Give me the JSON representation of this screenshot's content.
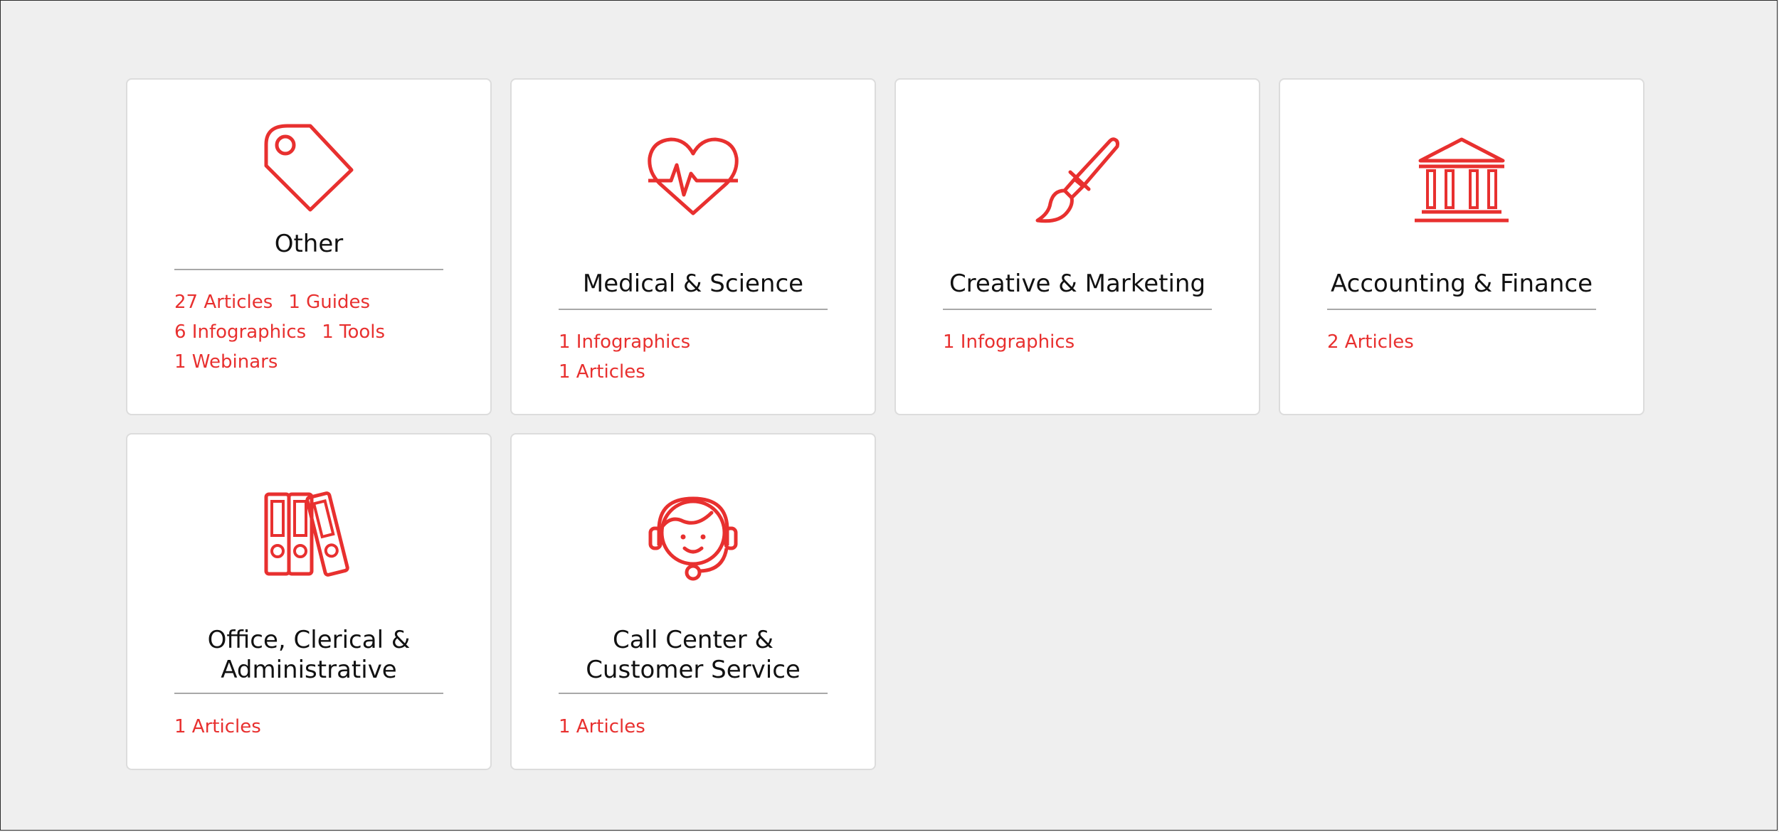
{
  "accent_color": "#e8302f",
  "cards": [
    {
      "icon": "tag-icon",
      "title": "Other",
      "links": [
        "27 Articles",
        "1 Guides",
        "6 Infographics",
        "1 Tools",
        "1 Webinars"
      ]
    },
    {
      "icon": "heartbeat-icon",
      "title": "Medical & Science",
      "links": [
        "1 Infographics",
        "1 Articles"
      ]
    },
    {
      "icon": "paintbrush-icon",
      "title": "Creative & Marketing",
      "links": [
        "1 Infographics"
      ]
    },
    {
      "icon": "bank-icon",
      "title": "Accounting & Finance",
      "links": [
        "2 Articles"
      ]
    },
    {
      "icon": "binders-icon",
      "title": "Office, Clerical & Administrative",
      "links": [
        "1 Articles"
      ]
    },
    {
      "icon": "headset-agent-icon",
      "title": "Call Center & Customer Service",
      "links": [
        "1 Articles"
      ]
    }
  ]
}
